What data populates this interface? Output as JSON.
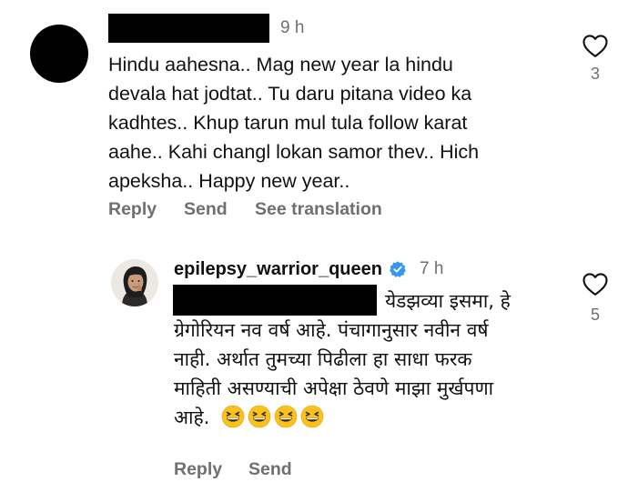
{
  "comment": {
    "time": "9 h",
    "lines": [
      "Hindu aahesna.. Mag new year la hindu",
      "devala hat jodtat.. Tu daru pitana video ka",
      "kadhtes.. Khup tarun mul tula follow karat",
      "aahe.. Kahi changl lokan samor thev.. Hich",
      "apeksha.. Happy new year.."
    ],
    "actions": {
      "reply": "Reply",
      "send": "Send",
      "see_translation": "See translation"
    },
    "likes": "3"
  },
  "reply": {
    "username": "epilepsy_warrior_queen",
    "time": "7 h",
    "lines": [
      "येडझव्या इसमा, हे",
      "ग्रेगोरियन नव वर्ष आहे. पंचागानुसार नवीन वर्ष",
      "नाही. अर्थात तुमच्या पिढीला हा साधा फरक",
      "माहिती असण्याची अपेक्षा ठेवणे माझा मुर्खपणा",
      "आहे."
    ],
    "emojis": [
      "grinning-squinting-face",
      "grinning-squinting-face",
      "grinning-squinting-face",
      "grinning-squinting-face"
    ],
    "actions": {
      "reply": "Reply",
      "send": "Send"
    },
    "likes": "5"
  },
  "colors": {
    "text": "#111111",
    "muted": "#6f6f6f",
    "verified": "#3897f0",
    "emoji_face": "#fcc21b"
  }
}
